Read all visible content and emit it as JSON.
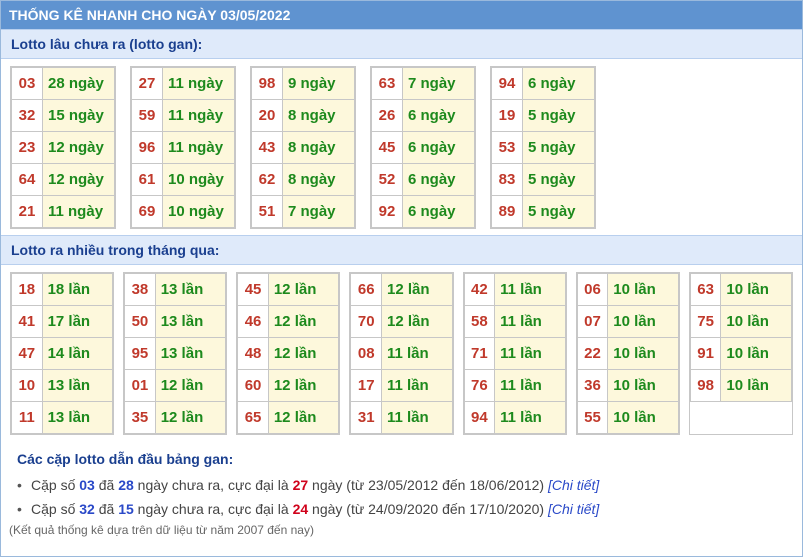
{
  "title": "THỐNG KÊ NHANH CHO NGÀY 03/05/2022",
  "gan": {
    "heading": "Lotto lâu chưa ra (lotto gan):",
    "groups": [
      [
        {
          "n": "03",
          "v": "28 ngày"
        },
        {
          "n": "32",
          "v": "15 ngày"
        },
        {
          "n": "23",
          "v": "12 ngày"
        },
        {
          "n": "64",
          "v": "12 ngày"
        },
        {
          "n": "21",
          "v": "11 ngày"
        }
      ],
      [
        {
          "n": "27",
          "v": "11 ngày"
        },
        {
          "n": "59",
          "v": "11 ngày"
        },
        {
          "n": "96",
          "v": "11 ngày"
        },
        {
          "n": "61",
          "v": "10 ngày"
        },
        {
          "n": "69",
          "v": "10 ngày"
        }
      ],
      [
        {
          "n": "98",
          "v": "9 ngày"
        },
        {
          "n": "20",
          "v": "8 ngày"
        },
        {
          "n": "43",
          "v": "8 ngày"
        },
        {
          "n": "62",
          "v": "8 ngày"
        },
        {
          "n": "51",
          "v": "7 ngày"
        }
      ],
      [
        {
          "n": "63",
          "v": "7 ngày"
        },
        {
          "n": "26",
          "v": "6 ngày"
        },
        {
          "n": "45",
          "v": "6 ngày"
        },
        {
          "n": "52",
          "v": "6 ngày"
        },
        {
          "n": "92",
          "v": "6 ngày"
        }
      ],
      [
        {
          "n": "94",
          "v": "6 ngày"
        },
        {
          "n": "19",
          "v": "5 ngày"
        },
        {
          "n": "53",
          "v": "5 ngày"
        },
        {
          "n": "83",
          "v": "5 ngày"
        },
        {
          "n": "89",
          "v": "5 ngày"
        }
      ]
    ]
  },
  "frequent": {
    "heading": "Lotto ra nhiều trong tháng qua:",
    "groups": [
      [
        {
          "n": "18",
          "v": "18 lần"
        },
        {
          "n": "41",
          "v": "17 lần"
        },
        {
          "n": "47",
          "v": "14 lần"
        },
        {
          "n": "10",
          "v": "13 lần"
        },
        {
          "n": "11",
          "v": "13 lần"
        }
      ],
      [
        {
          "n": "38",
          "v": "13 lần"
        },
        {
          "n": "50",
          "v": "13 lần"
        },
        {
          "n": "95",
          "v": "13 lần"
        },
        {
          "n": "01",
          "v": "12 lần"
        },
        {
          "n": "35",
          "v": "12 lần"
        }
      ],
      [
        {
          "n": "45",
          "v": "12 lần"
        },
        {
          "n": "46",
          "v": "12 lần"
        },
        {
          "n": "48",
          "v": "12 lần"
        },
        {
          "n": "60",
          "v": "12 lần"
        },
        {
          "n": "65",
          "v": "12 lần"
        }
      ],
      [
        {
          "n": "66",
          "v": "12 lần"
        },
        {
          "n": "70",
          "v": "12 lần"
        },
        {
          "n": "08",
          "v": "11 lần"
        },
        {
          "n": "17",
          "v": "11 lần"
        },
        {
          "n": "31",
          "v": "11 lần"
        }
      ],
      [
        {
          "n": "42",
          "v": "11 lần"
        },
        {
          "n": "58",
          "v": "11 lần"
        },
        {
          "n": "71",
          "v": "11 lần"
        },
        {
          "n": "76",
          "v": "11 lần"
        },
        {
          "n": "94",
          "v": "11 lần"
        }
      ],
      [
        {
          "n": "06",
          "v": "10 lần"
        },
        {
          "n": "07",
          "v": "10 lần"
        },
        {
          "n": "22",
          "v": "10 lần"
        },
        {
          "n": "36",
          "v": "10 lần"
        },
        {
          "n": "55",
          "v": "10 lần"
        }
      ],
      [
        {
          "n": "63",
          "v": "10 lần"
        },
        {
          "n": "75",
          "v": "10 lần"
        },
        {
          "n": "91",
          "v": "10 lần"
        },
        {
          "n": "98",
          "v": "10 lần"
        }
      ]
    ]
  },
  "pairs": {
    "heading": "Các cặp lotto dẫn đầu bảng gan:",
    "items": [
      {
        "p1": "Cặp số ",
        "num": "03",
        "p2": " đã ",
        "days": "28",
        "p3": " ngày chưa ra, cực đại là ",
        "max": "27",
        "p4": " ngày (từ 23/05/2012 đến 18/06/2012) ",
        "link": "[Chi tiết]"
      },
      {
        "p1": "Cặp số ",
        "num": "32",
        "p2": " đã ",
        "days": "15",
        "p3": " ngày chưa ra, cực đại là ",
        "max": "24",
        "p4": " ngày (từ 24/09/2020 đến 17/10/2020) ",
        "link": "[Chi tiết]"
      }
    ],
    "bullet": "•"
  },
  "note": "(Kết quả thống kê dựa trên dữ liệu từ năm 2007 đến nay)",
  "colors": {
    "header": "#5f93d0",
    "section": "#dfeafa",
    "number": "#c0392b",
    "value": "#1d8a1d",
    "cell_bg": "#fdf8dc"
  }
}
